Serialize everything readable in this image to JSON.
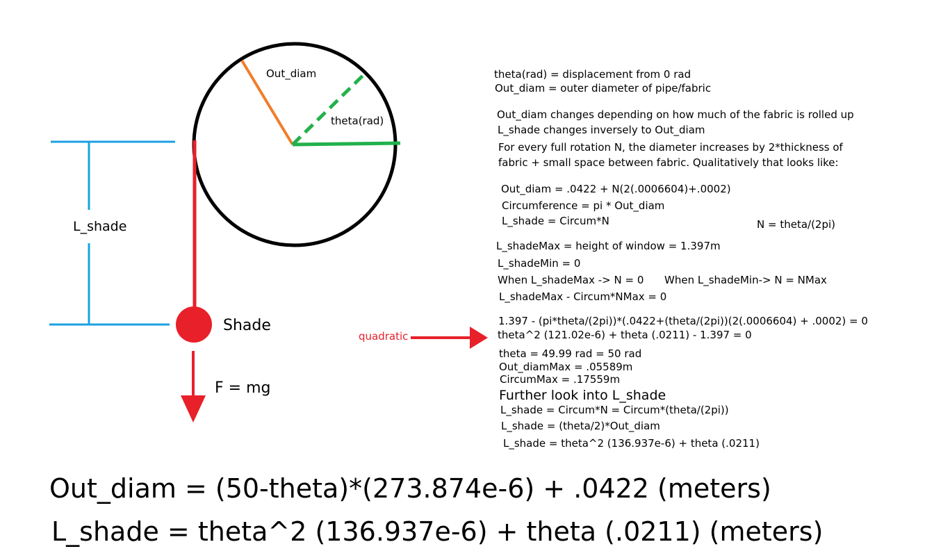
{
  "diagram": {
    "out_diam_label": "Out_diam",
    "theta_label": "theta(rad)",
    "l_shade_label": "L_shade",
    "shade_label": "Shade",
    "force_label": "F = mg",
    "quadratic_label": "quadratic"
  },
  "notes": {
    "line1": "theta(rad) = displacement from 0 rad",
    "line2": "Out_diam = outer diameter of pipe/fabric",
    "line3": "Out_diam changes depending on how much of the fabric is rolled up",
    "line4": "L_shade changes inversely to Out_diam",
    "line5": "For every full rotation N, the diameter increases by 2*thickness of",
    "line6": "fabric + small space between fabric. Qualitatively that looks like:",
    "eq1": "Out_diam = .0422 + N(2(.0006604)+.0002)",
    "eq2": "Circumference = pi * Out_diam",
    "eq3": "L_shade = Circum*N",
    "eq_n": "N = theta/(2pi)",
    "max1": "L_shadeMax = height of window = 1.397m",
    "min1": "L_shadeMin = 0",
    "when1": "When L_shadeMax -> N = 0",
    "when2": "When L_shadeMin-> N = NMax",
    "nmax": "L_shadeMax - Circum*NMax = 0",
    "quad1": "1.397 - (pi*theta/(2pi))*(.0422+(theta/(2pi))(2(.0006604) + .0002) = 0",
    "quad2": "theta^2 (121.02e-6) + theta (.0211) - 1.397 = 0",
    "res1": "theta = 49.99 rad = 50 rad",
    "res2": "Out_diamMax = .05589m",
    "res3": "CircumMax = .17559m",
    "further": "Further look into L_shade",
    "f1": "L_shade = Circum*N = Circum*(theta/(2pi))",
    "f2": "L_shade = (theta/2)*Out_diam",
    "f3": "L_shade = theta^2 (136.937e-6) + theta (.0211)"
  },
  "final": {
    "out_diam": "Out_diam = (50-theta)*(273.874e-6) + .0422 (meters)",
    "l_shade": "L_shade = theta^2 (136.937e-6) + theta (.0211) (meters)"
  },
  "colors": {
    "circle": "#000000",
    "radius_orange": "#f07e2a",
    "radius_green": "#22b14c",
    "cord_red": "#e8202a",
    "bracket_blue": "#1ba1e2"
  }
}
